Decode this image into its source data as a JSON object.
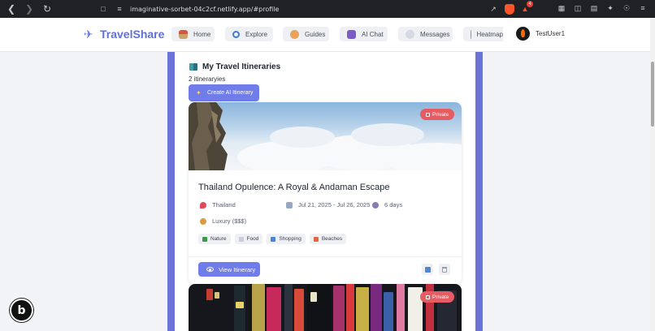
{
  "browser": {
    "url": "imaginative-sorbet-04c2cf.netlify.app/#profile",
    "notification_count": "4"
  },
  "header": {
    "logo_text": "TravelShare",
    "nav": [
      {
        "label": "Home",
        "icon": "home-icon"
      },
      {
        "label": "Explore",
        "icon": "magnifier-icon"
      },
      {
        "label": "Guides",
        "icon": "compass-icon"
      },
      {
        "label": "AI Chat",
        "icon": "robot-icon"
      },
      {
        "label": "Messages",
        "icon": "speech-bubble-icon"
      },
      {
        "label": "Heatmap",
        "icon": "fire-icon"
      }
    ],
    "user_name": "TestUser1"
  },
  "itineraries": {
    "section_title": "My Travel Itineraries",
    "count_text": "2 itineraryies",
    "create_button": "Create AI Itinerary",
    "cards": [
      {
        "title": "Thailand Opulence: A Royal & Andaman Escape",
        "privacy": "Private",
        "location": "Thailand",
        "dates": "Jul 21, 2025 - Jul 26, 2025",
        "duration": "6 days",
        "budget": "Luxury ($$$)",
        "tags": [
          "Nature",
          "Food",
          "Shopping",
          "Beaches"
        ],
        "view_button": "View Itinerary"
      },
      {
        "privacy": "Private"
      }
    ]
  },
  "colors": {
    "accent": "#6f7cea",
    "frame": "#6b72d8",
    "private": "#e55d62",
    "logo": "#5f6fd6"
  }
}
